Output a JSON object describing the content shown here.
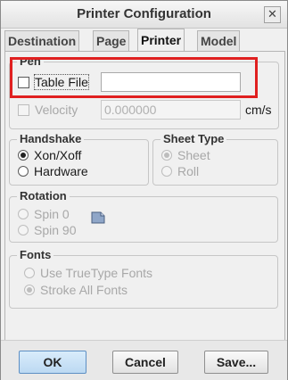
{
  "window": {
    "title": "Printer Configuration",
    "close_glyph": "✕"
  },
  "tabs": [
    {
      "label": "Destination",
      "active": false
    },
    {
      "label": "Page",
      "active": false
    },
    {
      "label": "Printer",
      "active": true
    },
    {
      "label": "Model",
      "active": false
    }
  ],
  "pen": {
    "group_label": "Pen",
    "table_file_label": "Table File",
    "table_file_checked": false,
    "table_file_value": "",
    "velocity_label": "Velocity",
    "velocity_value": "0.000000",
    "velocity_unit": "cm/s"
  },
  "handshake": {
    "group_label": "Handshake",
    "options": [
      {
        "label": "Xon/Xoff",
        "checked": true
      },
      {
        "label": "Hardware",
        "checked": false
      }
    ]
  },
  "sheet_type": {
    "group_label": "Sheet Type",
    "options": [
      {
        "label": "Sheet",
        "checked": true
      },
      {
        "label": "Roll",
        "checked": false
      }
    ]
  },
  "rotation": {
    "group_label": "Rotation",
    "options": [
      {
        "label": "Spin 0",
        "checked": false
      },
      {
        "label": "Spin 90",
        "checked": false
      }
    ],
    "icon": "paper-icon"
  },
  "fonts": {
    "group_label": "Fonts",
    "options": [
      {
        "label": "Use TrueType Fonts",
        "checked": false
      },
      {
        "label": "Stroke All Fonts",
        "checked": true
      }
    ]
  },
  "buttons": {
    "ok": "OK",
    "cancel": "Cancel",
    "save": "Save..."
  },
  "colors": {
    "highlight": "#e02020",
    "ok_button": "#bcd9f2"
  }
}
